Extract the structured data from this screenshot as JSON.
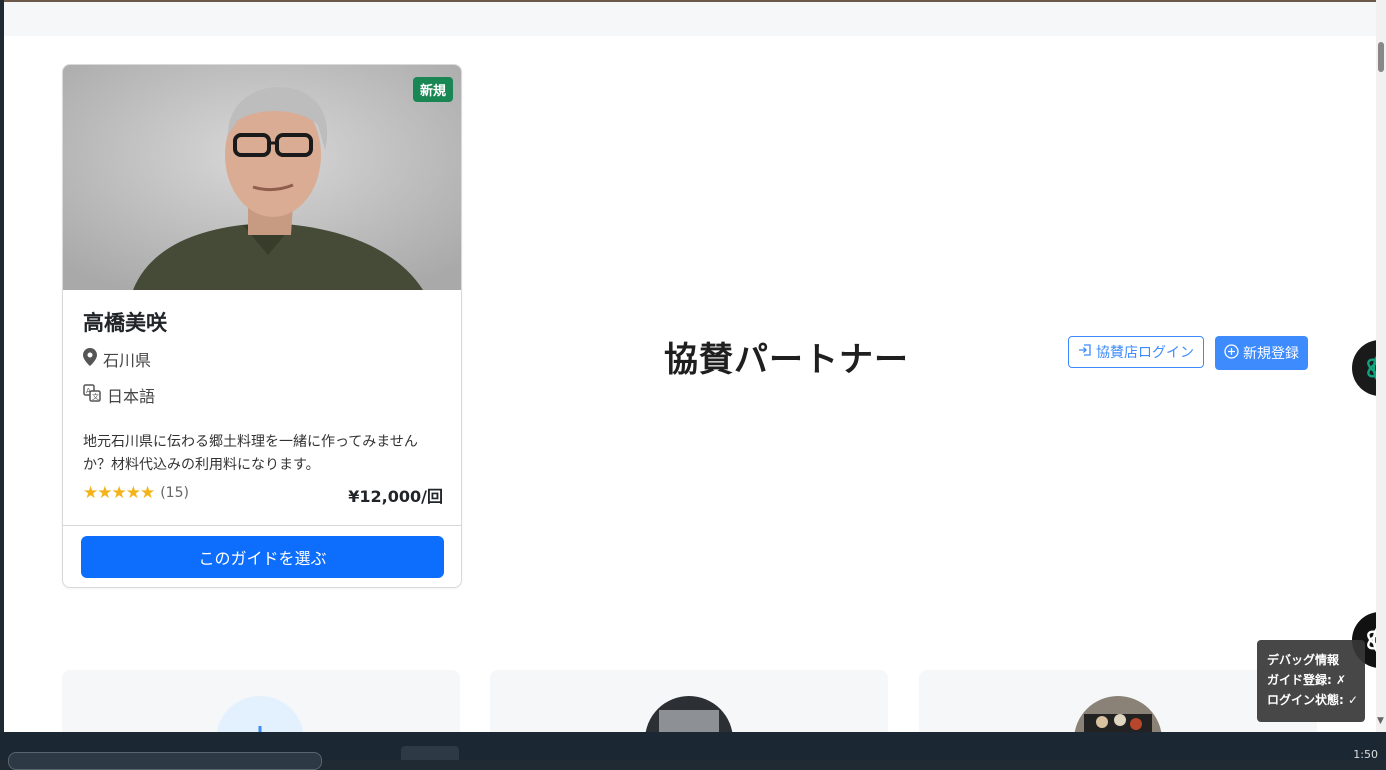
{
  "guide_card": {
    "badge": "新規",
    "name": "高橋美咲",
    "prefecture": "石川県",
    "language": "日本語",
    "description": "地元石川県に伝わる郷土料理を一緒に作ってみませんか？材料代込みの利用料になります。",
    "stars": "★★★★★",
    "rating_value": 5,
    "review_count": "(15)",
    "price": "¥12,000/回",
    "select_button": "このガイドを選ぶ"
  },
  "sponsor": {
    "title": "協賛パートナー",
    "login_button": "協賛店ログイン",
    "register_button": "新規登録"
  },
  "debug": {
    "title": "デバッグ情報",
    "guide_registration": "ガイド登録: ✗",
    "login_state": "ログイン状態: ✓"
  },
  "taskbar": {
    "time": "1:50"
  },
  "colors": {
    "primary": "#0d6efd",
    "primary_light": "#3d8bfd",
    "badge_green": "#198754",
    "star": "#f3b41b"
  },
  "icons": [
    "location-pin-icon",
    "translate-icon",
    "login-icon",
    "plus-circle-icon",
    "openai-icon"
  ]
}
